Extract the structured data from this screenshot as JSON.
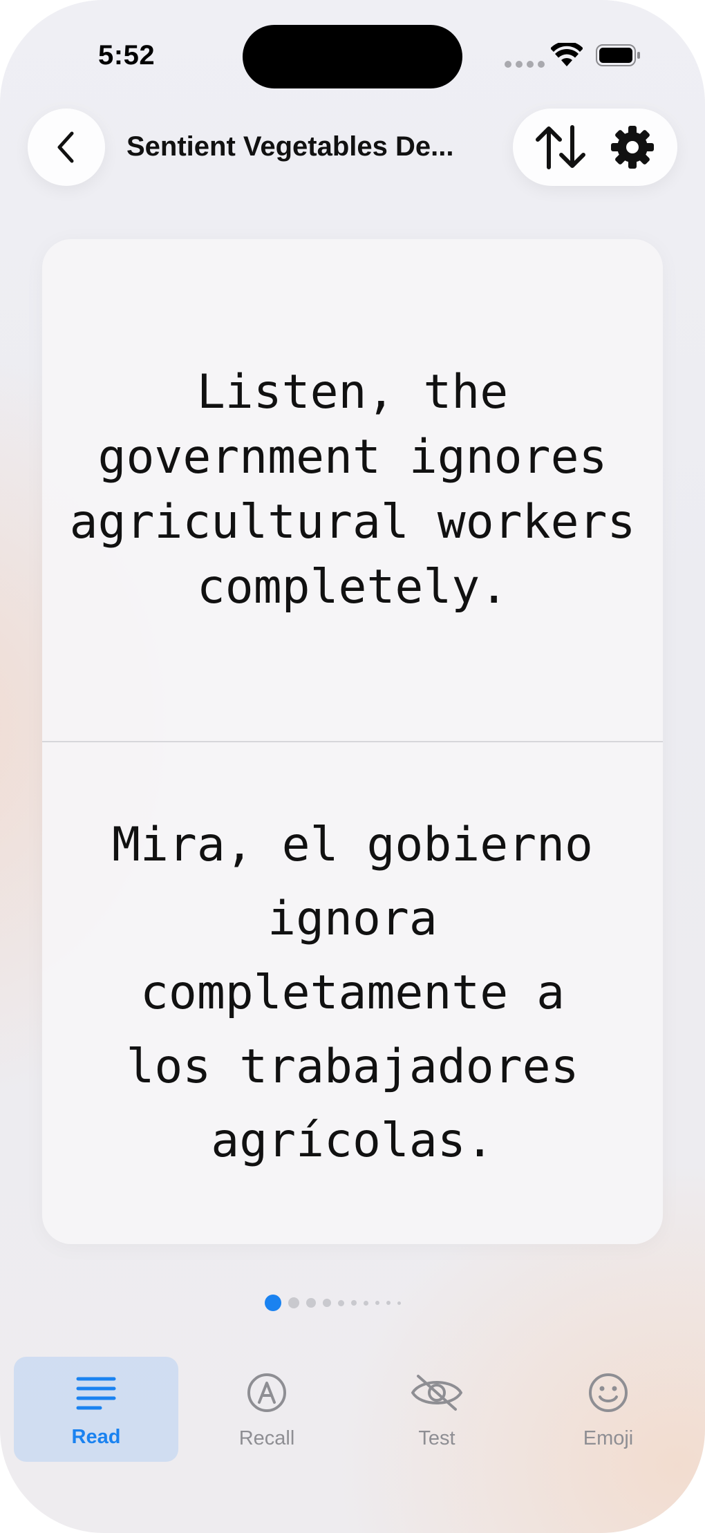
{
  "status_bar": {
    "time": "5:52"
  },
  "nav": {
    "title": "Sentient Vegetables De..."
  },
  "card": {
    "source_text": "Listen, the government ignores agricultural workers completely.",
    "translation_text": "Mira, el gobierno ignora completamente a los trabajadores agrícolas."
  },
  "pager": {
    "total": 10,
    "current": 1
  },
  "tabs": [
    {
      "label": "Read",
      "icon": "lines-icon",
      "active": true
    },
    {
      "label": "Recall",
      "icon": "letter-a-circle-icon",
      "active": false
    },
    {
      "label": "Test",
      "icon": "eye-slash-icon",
      "active": false
    },
    {
      "label": "Emoji",
      "icon": "smiley-icon",
      "active": false
    }
  ],
  "colors": {
    "accent": "#1a82f0",
    "inactive": "#8e8e93"
  }
}
